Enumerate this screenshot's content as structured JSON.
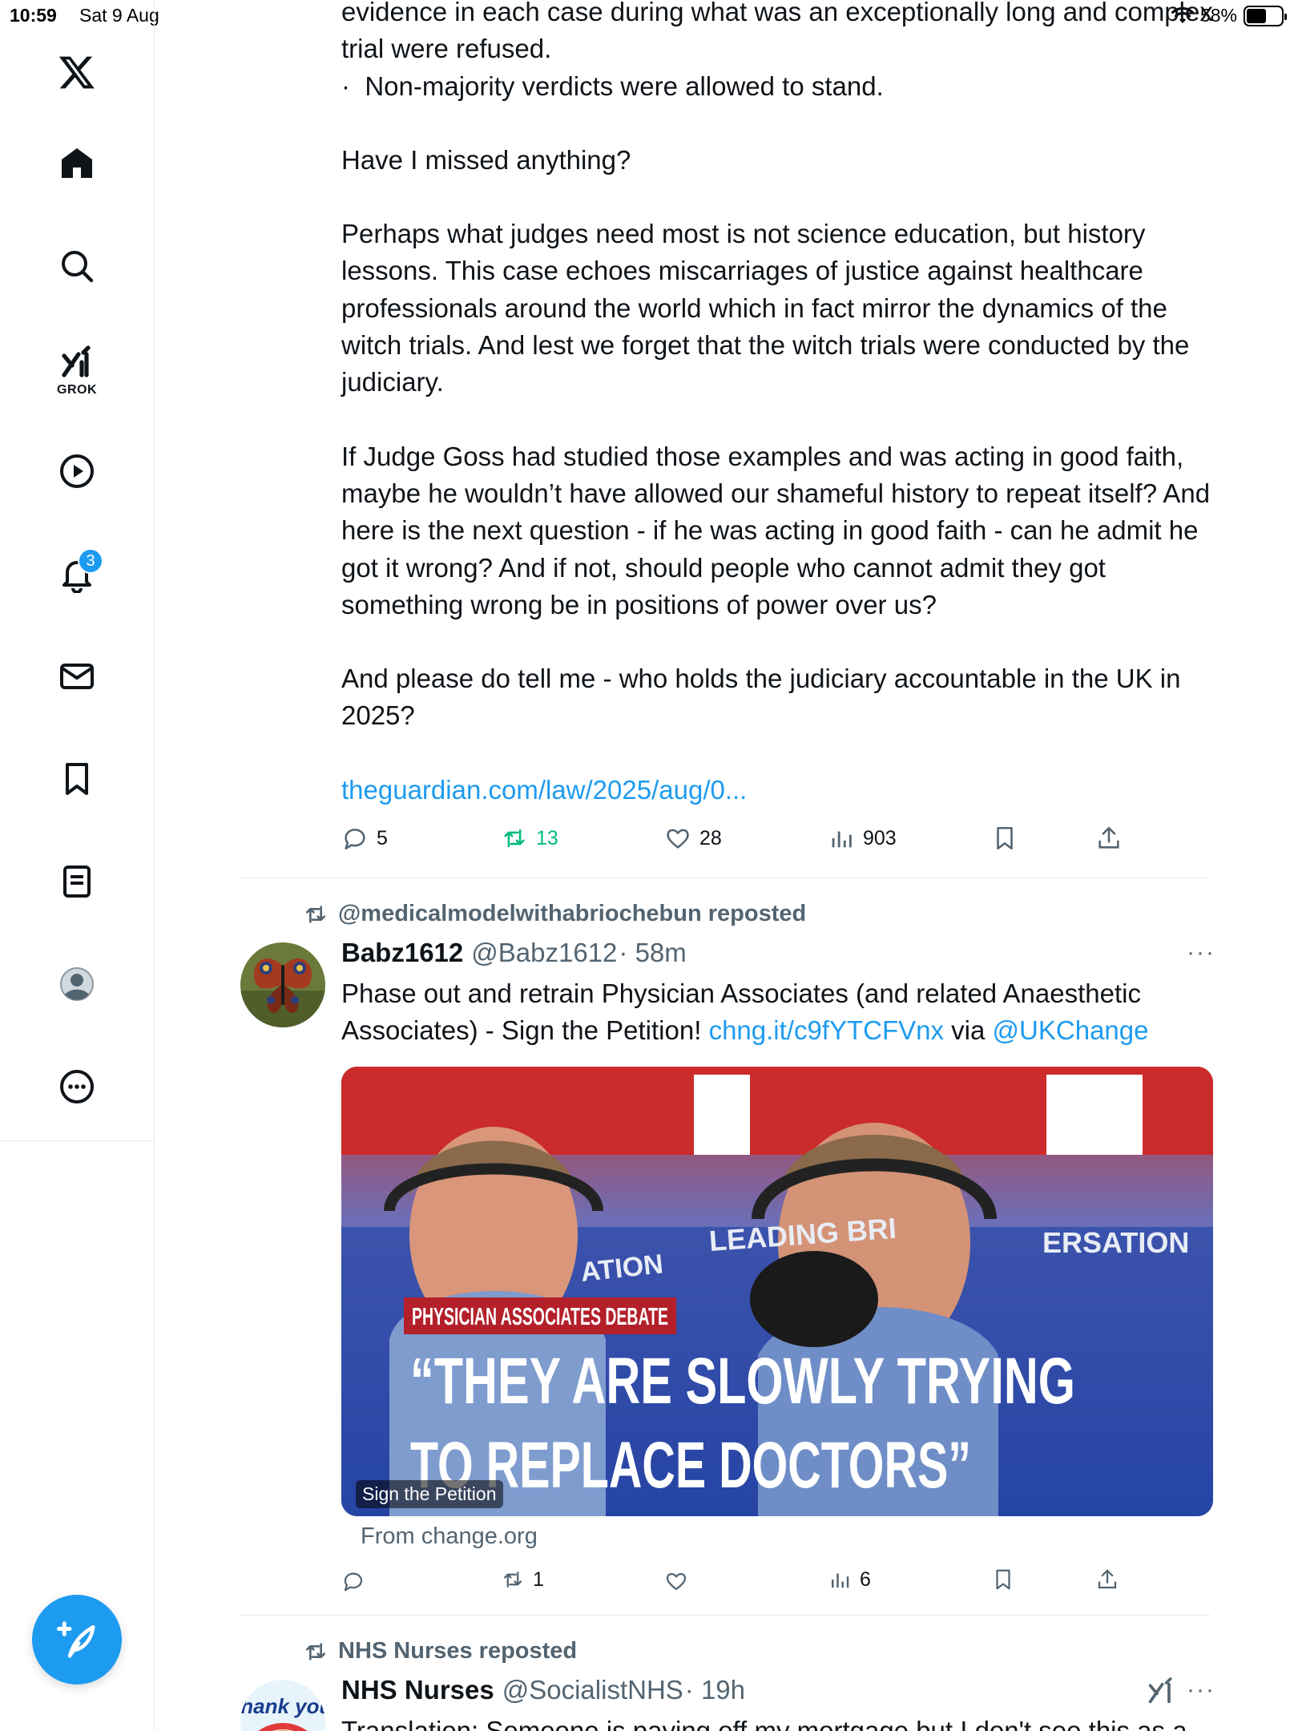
{
  "status_bar": {
    "time": "10:59",
    "date": "Sat 9 Aug",
    "battery": "58%",
    "battery_level": 0.58
  },
  "sidebar": {
    "items": [
      {
        "name": "x-logo-icon"
      },
      {
        "name": "home-icon"
      },
      {
        "name": "search-icon"
      },
      {
        "name": "grok-icon",
        "label": "GROK"
      },
      {
        "name": "video-icon"
      },
      {
        "name": "notifications-icon",
        "badge": "3"
      },
      {
        "name": "messages-icon"
      },
      {
        "name": "bookmarks-icon"
      },
      {
        "name": "lists-icon"
      },
      {
        "name": "profile-icon"
      },
      {
        "name": "more-icon"
      }
    ]
  },
  "tweet1": {
    "lines": [
      "evidence in each case during what was an exceptionally long and complex trial were refused.",
      "·  Non-majority verdicts were allowed to stand.",
      "Have I missed anything?",
      "Perhaps what judges need most is not science education, but history lessons. This case echoes miscarriages of justice against healthcare professionals around the world which in fact mirror the dynamics of the witch trials. And lest we forget that the witch trials were conducted by the judiciary.",
      "If Judge Goss had studied those examples and was acting in good faith, maybe he wouldn’t have allowed our shameful history to repeat itself? And here is the next question - if he was acting in good faith - can he admit he got it wrong? And if not, should people who cannot admit they got something wrong be in positions of power over us?",
      "And please do tell me - who holds the judiciary accountable in the UK in 2025?"
    ],
    "link": "theguardian.com/law/2025/aug/0...",
    "replies": "5",
    "reposts": "13",
    "likes": "28",
    "views": "903"
  },
  "tweet2": {
    "repost_by": "@medicalmodelwithabriochebun reposted",
    "name": "Babz1612",
    "handle": "@Babz1612",
    "time": "· 58m",
    "more": "···",
    "text_plain": "Phase out and retrain Physician Associates (and related Anaesthetic Associates) - Sign the Petition! ",
    "text_link": "chng.it/c9fYTCFVnx",
    "text_via": " via ",
    "text_mention": "@UKChange",
    "card": {
      "banner_left": "LEADING BRI",
      "banner_left2": "ATION",
      "banner_right": "ERSATION",
      "tag": "PHYSICIAN ASSOCIATES DEBATE",
      "quote_line1": "“THEY ARE SLOWLY TRYING",
      "quote_line2": "TO REPLACE DOCTORS”",
      "label": "Sign the Petition",
      "from": "From change.org"
    },
    "replies": "",
    "reposts": "1",
    "likes": "",
    "views": "6"
  },
  "tweet3": {
    "repost_by": "NHS Nurses reposted",
    "name": "NHS Nurses",
    "handle": "@SocialistNHS",
    "time": "· 19h",
    "more": "···",
    "avatar_text": "thank you",
    "text": "Translation: Someone is paying off my mortgage but I don't see this as a"
  }
}
